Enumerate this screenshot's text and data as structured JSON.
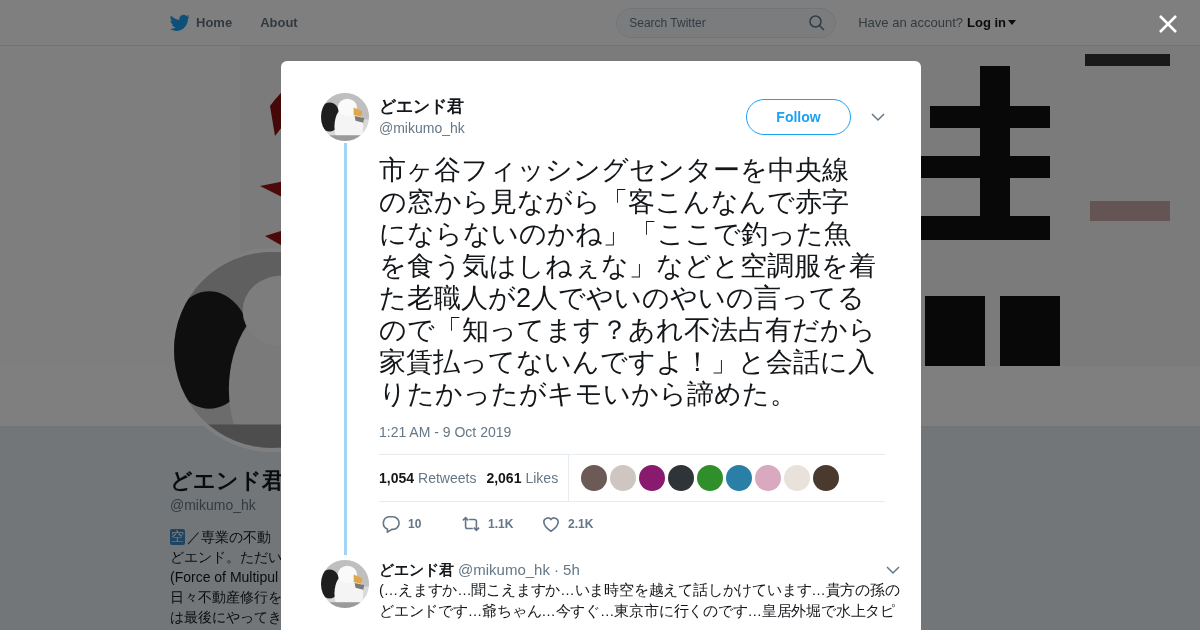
{
  "nav": {
    "items": [
      {
        "label": "Home",
        "kind": "home"
      },
      {
        "label": "About",
        "kind": "plain"
      }
    ],
    "search": {
      "placeholder": "Search Twitter"
    },
    "account_prompt": "Have an account?",
    "login": "Log in"
  },
  "profile": {
    "name": "どエンド君",
    "handle": "@mikumo_hk",
    "bio_badge": "空",
    "bio_lines": [
      "／専業の不動",
      "どエンド。ただい",
      "(Force of Multipul",
      "日々不動産修行を",
      "は最後にやってき"
    ]
  },
  "tweet": {
    "name": "どエンド君",
    "handle": "@mikumo_hk",
    "follow": "Follow",
    "text_lines": [
      "市ヶ谷フィッシングセンターを中央線",
      "の窓から見ながら「客こんなんで赤字",
      "にならないのかね」「ここで釣った魚",
      "を食う気はしねぇな」などと空調服を着",
      "た老職人が2人でやいのやいの言ってる",
      "ので「知ってます？あれ不法占有だから",
      "家賃払ってないんですよ！」と会話に入",
      "りたかったがキモいから諦めた。"
    ],
    "time": "1:21 AM - 9 Oct 2019",
    "retweets": "1,054",
    "retweets_label": "Retweets",
    "likes": "2,061",
    "likes_label": "Likes",
    "likers": [
      {
        "color": "#6b5a55"
      },
      {
        "color": "#cfc6c2"
      },
      {
        "color": "#8a1a6e"
      },
      {
        "color": "#2e3438"
      },
      {
        "color": "#2f8f2a"
      },
      {
        "color": "#2a7fa6"
      },
      {
        "color": "#d9a9c0"
      },
      {
        "color": "#e8e2da"
      },
      {
        "color": "#4a3a2e"
      }
    ],
    "actions": [
      {
        "kind": "reply",
        "count": "10"
      },
      {
        "kind": "retweet",
        "count": "1.1K"
      },
      {
        "kind": "like",
        "count": "2.1K"
      }
    ]
  },
  "reply": {
    "name": "どエンド君",
    "handle": "@mikumo_hk",
    "time": "· 5h",
    "text_lines": [
      "(…えますか…聞こえますか…いま時空を越えて話しかけています…貴方の孫の",
      "どエンドです…爺ちゃん…今すぐ…東京市に行くのです…皇居外堀で水上タピ"
    ]
  }
}
